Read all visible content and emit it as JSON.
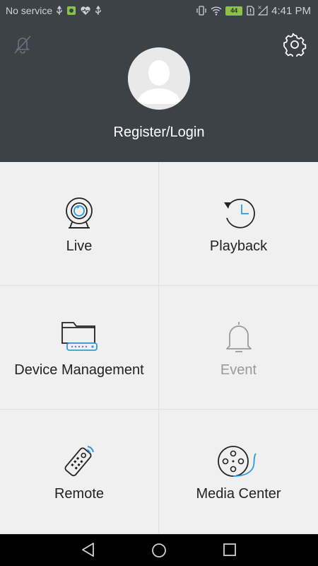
{
  "status_bar": {
    "carrier": "No service",
    "battery": "44",
    "time": "4:41 PM"
  },
  "header": {
    "login_label": "Register/Login",
    "icons": [
      "bell-off-icon",
      "gear-icon",
      "avatar"
    ]
  },
  "menu": [
    {
      "label": "Live",
      "icon": "webcam-icon"
    },
    {
      "label": "Playback",
      "icon": "playback-clock-icon"
    },
    {
      "label": "Device Management",
      "icon": "folder-device-icon"
    },
    {
      "label": "Event",
      "icon": "bell-icon",
      "disabled": true
    },
    {
      "label": "Remote",
      "icon": "remote-control-icon"
    },
    {
      "label": "Media Center",
      "icon": "film-reel-icon"
    }
  ],
  "colors": {
    "header_bg": "#3d4148",
    "accent": "#2f9ae0",
    "grid_bg": "#f0f0f0"
  }
}
